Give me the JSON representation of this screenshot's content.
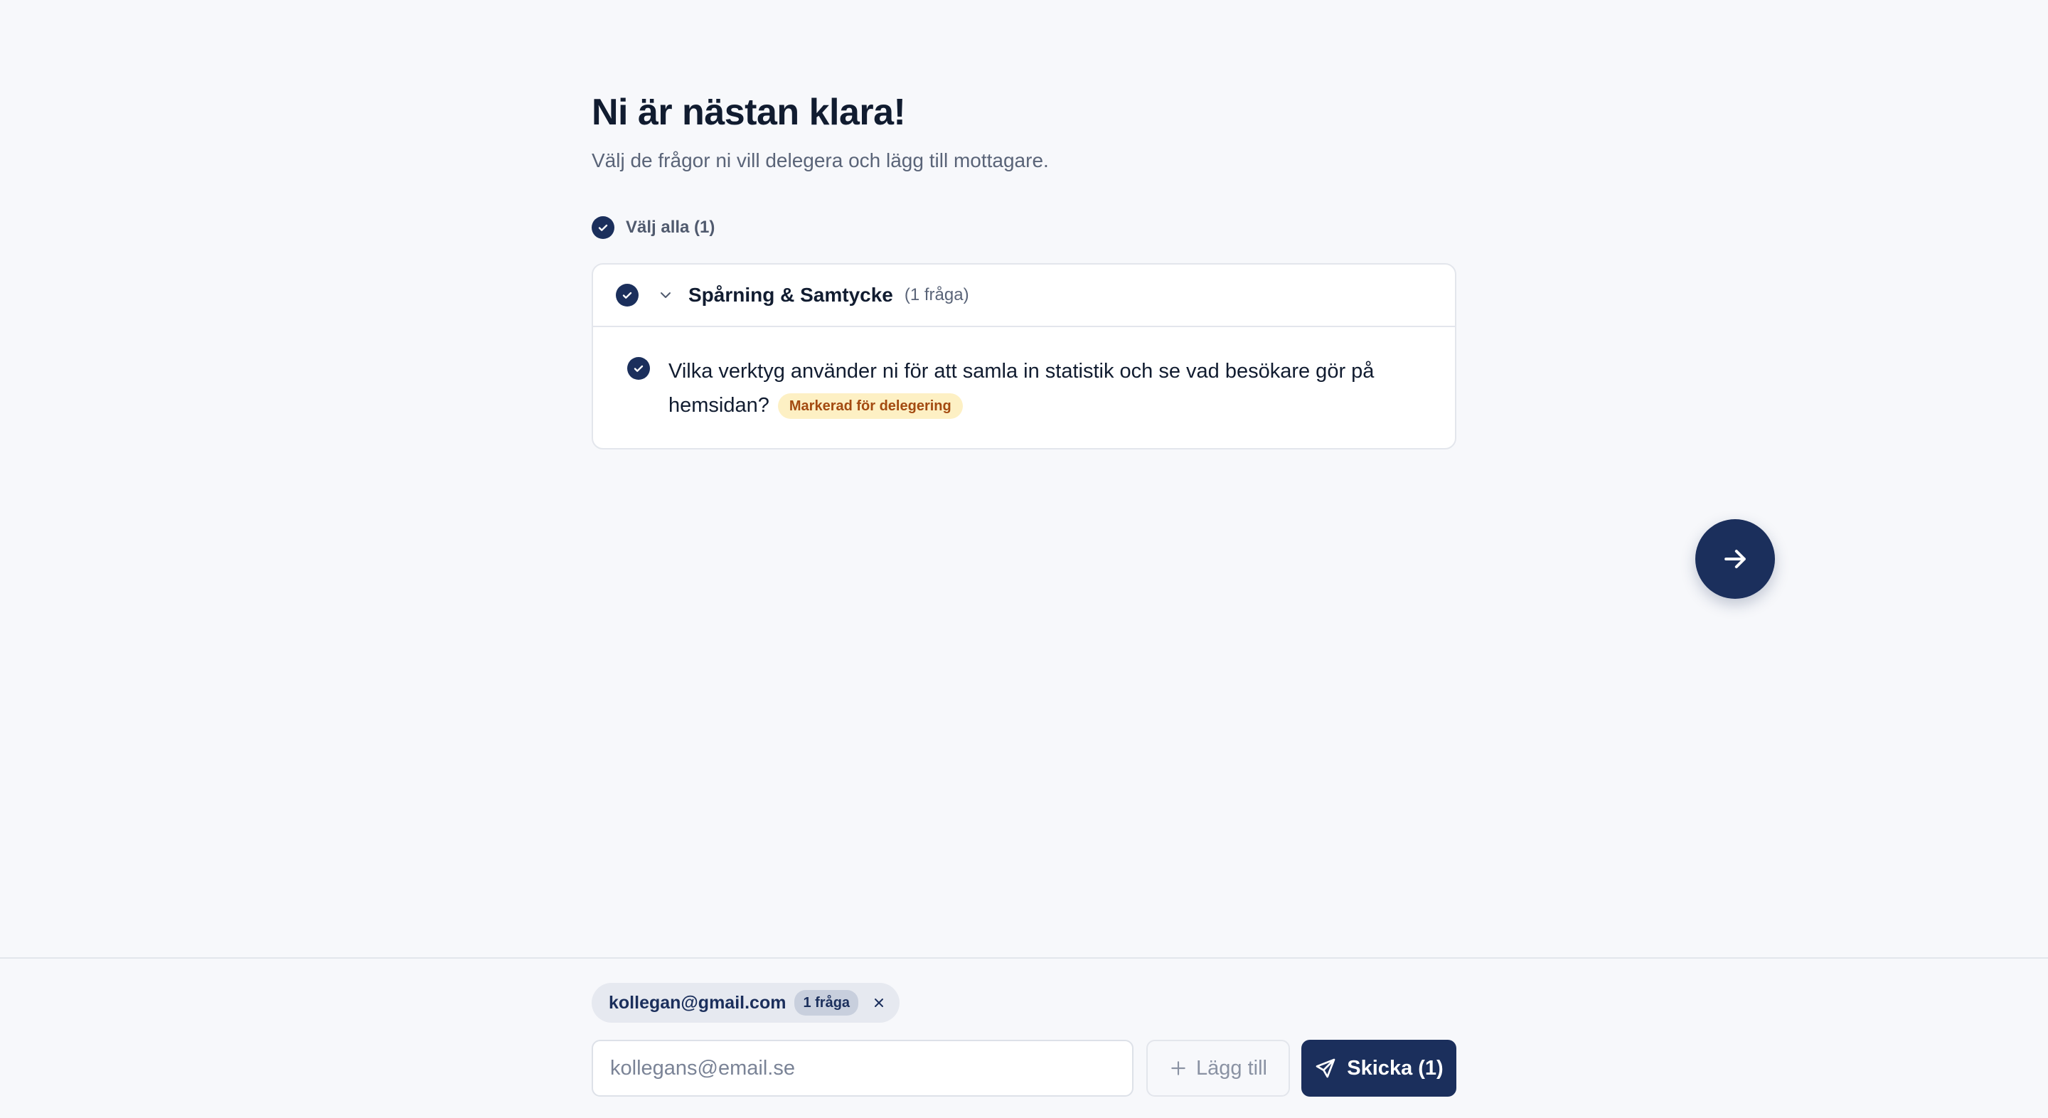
{
  "header": {
    "title": "Ni är nästan klara!",
    "subtitle": "Välj de frågor ni vill delegera och lägg till mottagare."
  },
  "select_all": {
    "label": "Välj alla (1)",
    "checked": true
  },
  "category": {
    "title": "Spårning & Samtycke",
    "count": "(1 fråga)",
    "checked": true,
    "expanded": true,
    "questions": [
      {
        "text": "Vilka verktyg använder ni för att samla in statistik och se vad besökare gör på hemsidan?",
        "badge": "Markerad för delegering",
        "checked": true
      }
    ]
  },
  "next_button": {
    "icon": "arrow-right-icon"
  },
  "recipients": [
    {
      "email": "kollegan@gmail.com",
      "count": "1 fråga"
    }
  ],
  "email_input": {
    "value": "",
    "placeholder": "kollegans@email.se"
  },
  "add_button": {
    "label": "Lägg till",
    "icon": "plus-icon"
  },
  "send_button": {
    "label": "Skicka (1)",
    "icon": "send-icon"
  },
  "colors": {
    "primary": "#1b2f5c",
    "background": "#f7f8fb",
    "badge_bg": "#fdf0c4",
    "badge_text": "#a34a10"
  }
}
